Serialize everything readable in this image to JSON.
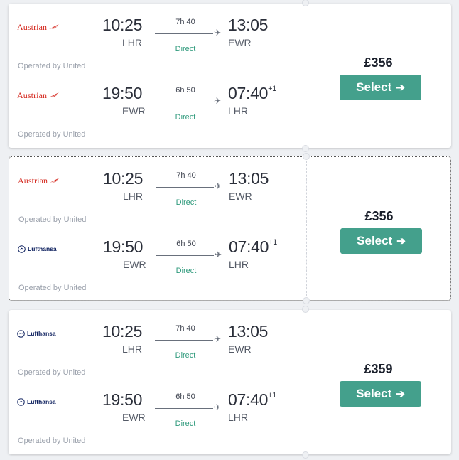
{
  "results": [
    {
      "price": "£356",
      "select_label": "Select",
      "legs": [
        {
          "airline": "Austrian",
          "airline_logo": "austrian",
          "dep_time": "10:25",
          "dep_code": "LHR",
          "duration": "7h 40",
          "stops": "Direct",
          "arr_time": "13:05",
          "arr_code": "EWR",
          "day_offset": "",
          "operated_by": "Operated by United"
        },
        {
          "airline": "Austrian",
          "airline_logo": "austrian",
          "dep_time": "19:50",
          "dep_code": "EWR",
          "duration": "6h 50",
          "stops": "Direct",
          "arr_time": "07:40",
          "arr_code": "LHR",
          "day_offset": "+1",
          "operated_by": "Operated by United"
        }
      ]
    },
    {
      "price": "£356",
      "select_label": "Select",
      "legs": [
        {
          "airline": "Austrian",
          "airline_logo": "austrian",
          "dep_time": "10:25",
          "dep_code": "LHR",
          "duration": "7h 40",
          "stops": "Direct",
          "arr_time": "13:05",
          "arr_code": "EWR",
          "day_offset": "",
          "operated_by": "Operated by United"
        },
        {
          "airline": "Lufthansa",
          "airline_logo": "lufthansa",
          "dep_time": "19:50",
          "dep_code": "EWR",
          "duration": "6h 50",
          "stops": "Direct",
          "arr_time": "07:40",
          "arr_code": "LHR",
          "day_offset": "+1",
          "operated_by": "Operated by United"
        }
      ]
    },
    {
      "price": "£359",
      "select_label": "Select",
      "legs": [
        {
          "airline": "Lufthansa",
          "airline_logo": "lufthansa",
          "dep_time": "10:25",
          "dep_code": "LHR",
          "duration": "7h 40",
          "stops": "Direct",
          "arr_time": "13:05",
          "arr_code": "EWR",
          "day_offset": "",
          "operated_by": "Operated by United"
        },
        {
          "airline": "Lufthansa",
          "airline_logo": "lufthansa",
          "dep_time": "19:50",
          "dep_code": "EWR",
          "duration": "6h 50",
          "stops": "Direct",
          "arr_time": "07:40",
          "arr_code": "LHR",
          "day_offset": "+1",
          "operated_by": "Operated by United"
        }
      ]
    }
  ],
  "icons": {
    "plane": "plane-icon",
    "arrow": "arrow-right-icon"
  },
  "colors": {
    "accent": "#44a08c",
    "direct": "#2f9a7c",
    "austrian": "#d4261c",
    "lufthansa": "#0a1d5c"
  }
}
